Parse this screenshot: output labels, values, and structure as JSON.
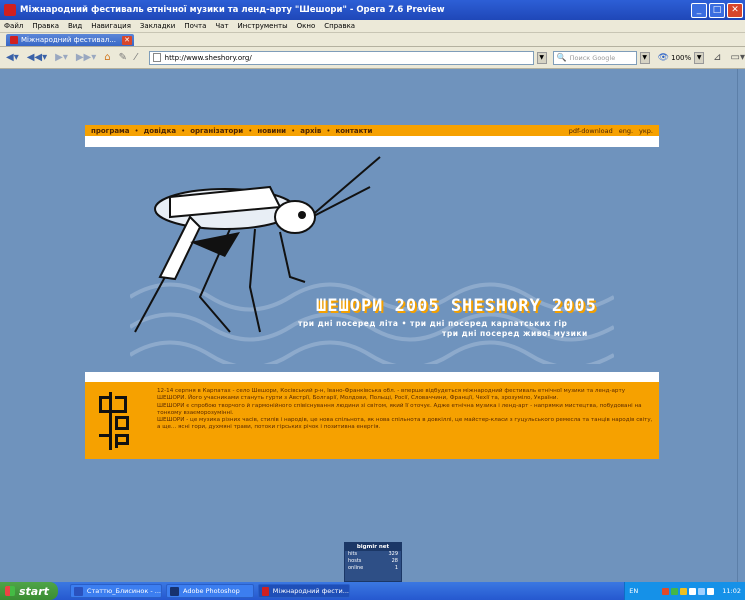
{
  "window": {
    "title": "Міжнародний фестиваль етнічної музики та ленд-арту \"Шешори\" - Opera 7.6 Preview"
  },
  "menu": [
    "Файл",
    "Правка",
    "Вид",
    "Навигация",
    "Закладки",
    "Почта",
    "Чат",
    "Инструменты",
    "Окно",
    "Справка"
  ],
  "tab": {
    "label": "Міжнародний фестивал..."
  },
  "toolbar": {
    "url": "http://www.sheshory.org/",
    "search_placeholder": "Поиск Google",
    "zoom": "100%"
  },
  "site": {
    "nav": [
      "програма",
      "довідка",
      "організатори",
      "новини",
      "архів",
      "контакти"
    ],
    "nav_separator": "•",
    "nav_right": [
      "pdf-download",
      "eng.",
      "укр."
    ],
    "banner_title": "ШЕШОРИ 2005 SHESHORY 2005",
    "banner_subtitle": "три дні посеред літа • три дні посеред карпатських гір",
    "banner_subtitle2": "три дні посеред живої музики",
    "info_p1": "12-14 серпня в Карпатах - село Шешори, Косівський р-н, Івано-Франківська обл. - вперше відбудеться міжнародний фестиваль етнічної музики та ленд-арту ШЕШОРИ. Його учасниками стануть гурти з Австрії, Болгарії, Молдови, Польщі, Росії, Словаччини, Франції, Чехії та, зрозуміло, України.",
    "info_p2": "ШЕШОРИ є спробою творчого й гармонійного співіснування людини зі світом, який її оточує. Адже етнічна музика і ленд-арт - напрямки мистецтва, побудовані на тонкому взаєморозумінні.",
    "info_p3": "ШЕШОРИ - це музика різних часів, стилів і народів, це нова спільнота, як нова спільнота в довкіллі, це майстер-класи з гуцульського ремесла та танців народів світу, а ще... ясні гори, духмяні трави, потоки гірських річок і позитивна енергія.",
    "counter": {
      "header": "bigmir net",
      "rows": [
        {
          "label": "hits",
          "value": "329"
        },
        {
          "label": "hosts",
          "value": "28"
        },
        {
          "label": "online",
          "value": "1"
        }
      ]
    }
  },
  "taskbar": {
    "start": "start",
    "tasks": [
      "Статтю_Блисинок - ...",
      "Adobe Photoshop",
      "Міжнародний фести..."
    ],
    "lang": "EN",
    "clock": "11:02"
  }
}
